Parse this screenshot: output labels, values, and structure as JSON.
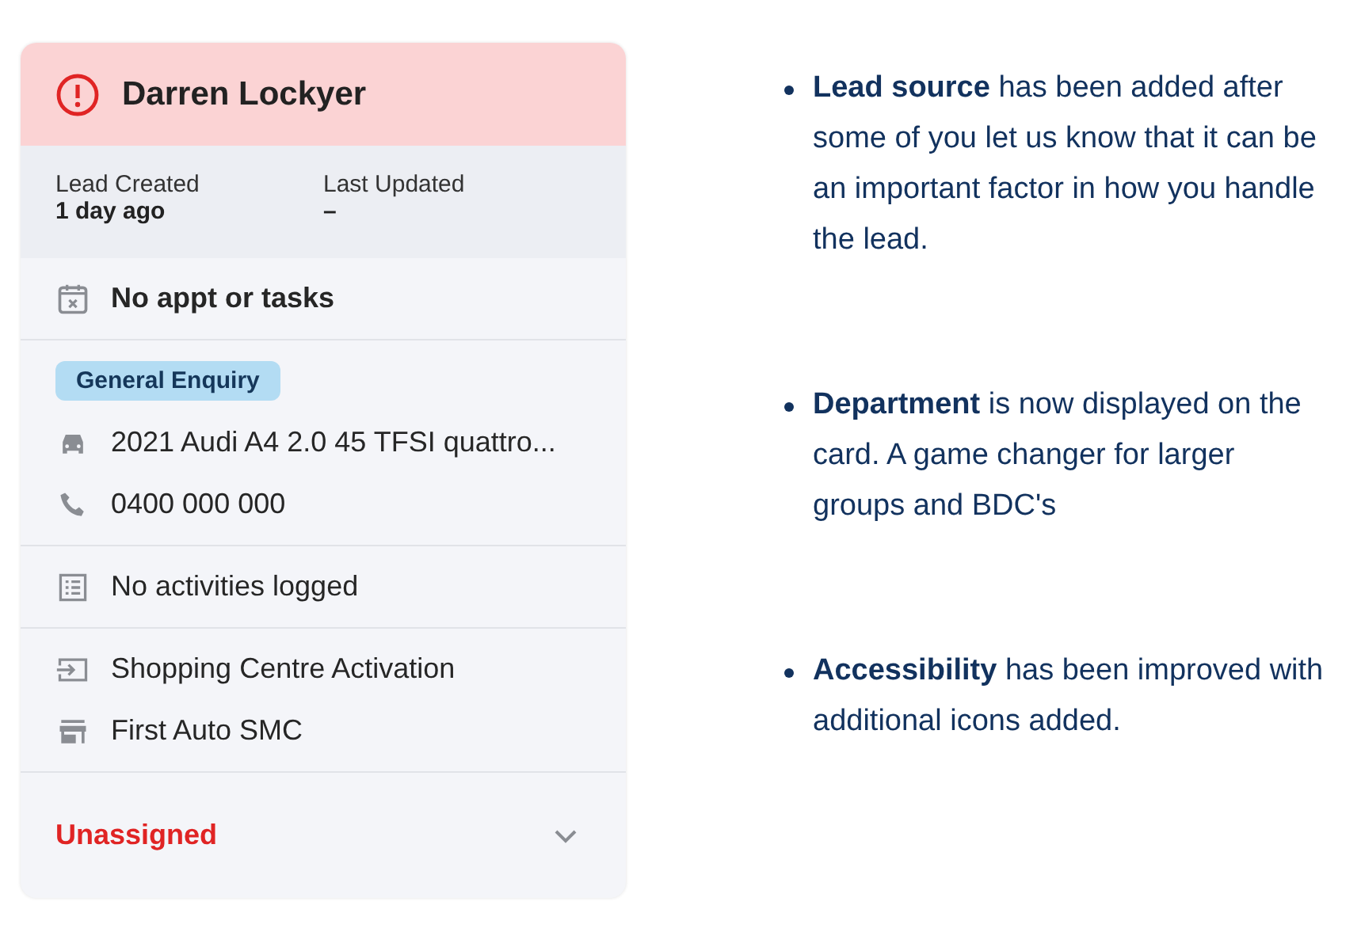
{
  "card": {
    "name": "Darren Lockyer",
    "alert": true,
    "dates": [
      {
        "label": "Lead Created",
        "value": "1 day ago"
      },
      {
        "label": "Last Updated",
        "value": "–"
      }
    ],
    "sections": [
      {
        "rows": [
          {
            "kind": "calendar",
            "text": "No appt or tasks",
            "bold": true
          }
        ]
      },
      {
        "rows": [
          {
            "kind": "tag",
            "text": "General Enquiry"
          },
          {
            "kind": "vehicle",
            "text": "2021 Audi A4 2.0 45 TFSI quattro..."
          },
          {
            "kind": "phone",
            "text": "0400 000 000"
          }
        ]
      },
      {
        "rows": [
          {
            "kind": "list",
            "text": "No activities logged"
          }
        ]
      },
      {
        "rows": [
          {
            "kind": "source",
            "text": "Shopping Centre Activation"
          },
          {
            "kind": "store",
            "text": "First Auto SMC"
          }
        ]
      }
    ],
    "assignee": {
      "text": "Unassigned",
      "assigned": false,
      "expanded": false
    }
  },
  "notes": [
    {
      "text": "**Lead source** has been added after some of you let us know that it can be an important factor in how you handle the lead."
    },
    {
      "text": "**Department** is now displayed on the card. A game changer for larger groups and BDC's"
    },
    {
      "text": "**Accessibility** has been improved with additional icons added."
    }
  ]
}
